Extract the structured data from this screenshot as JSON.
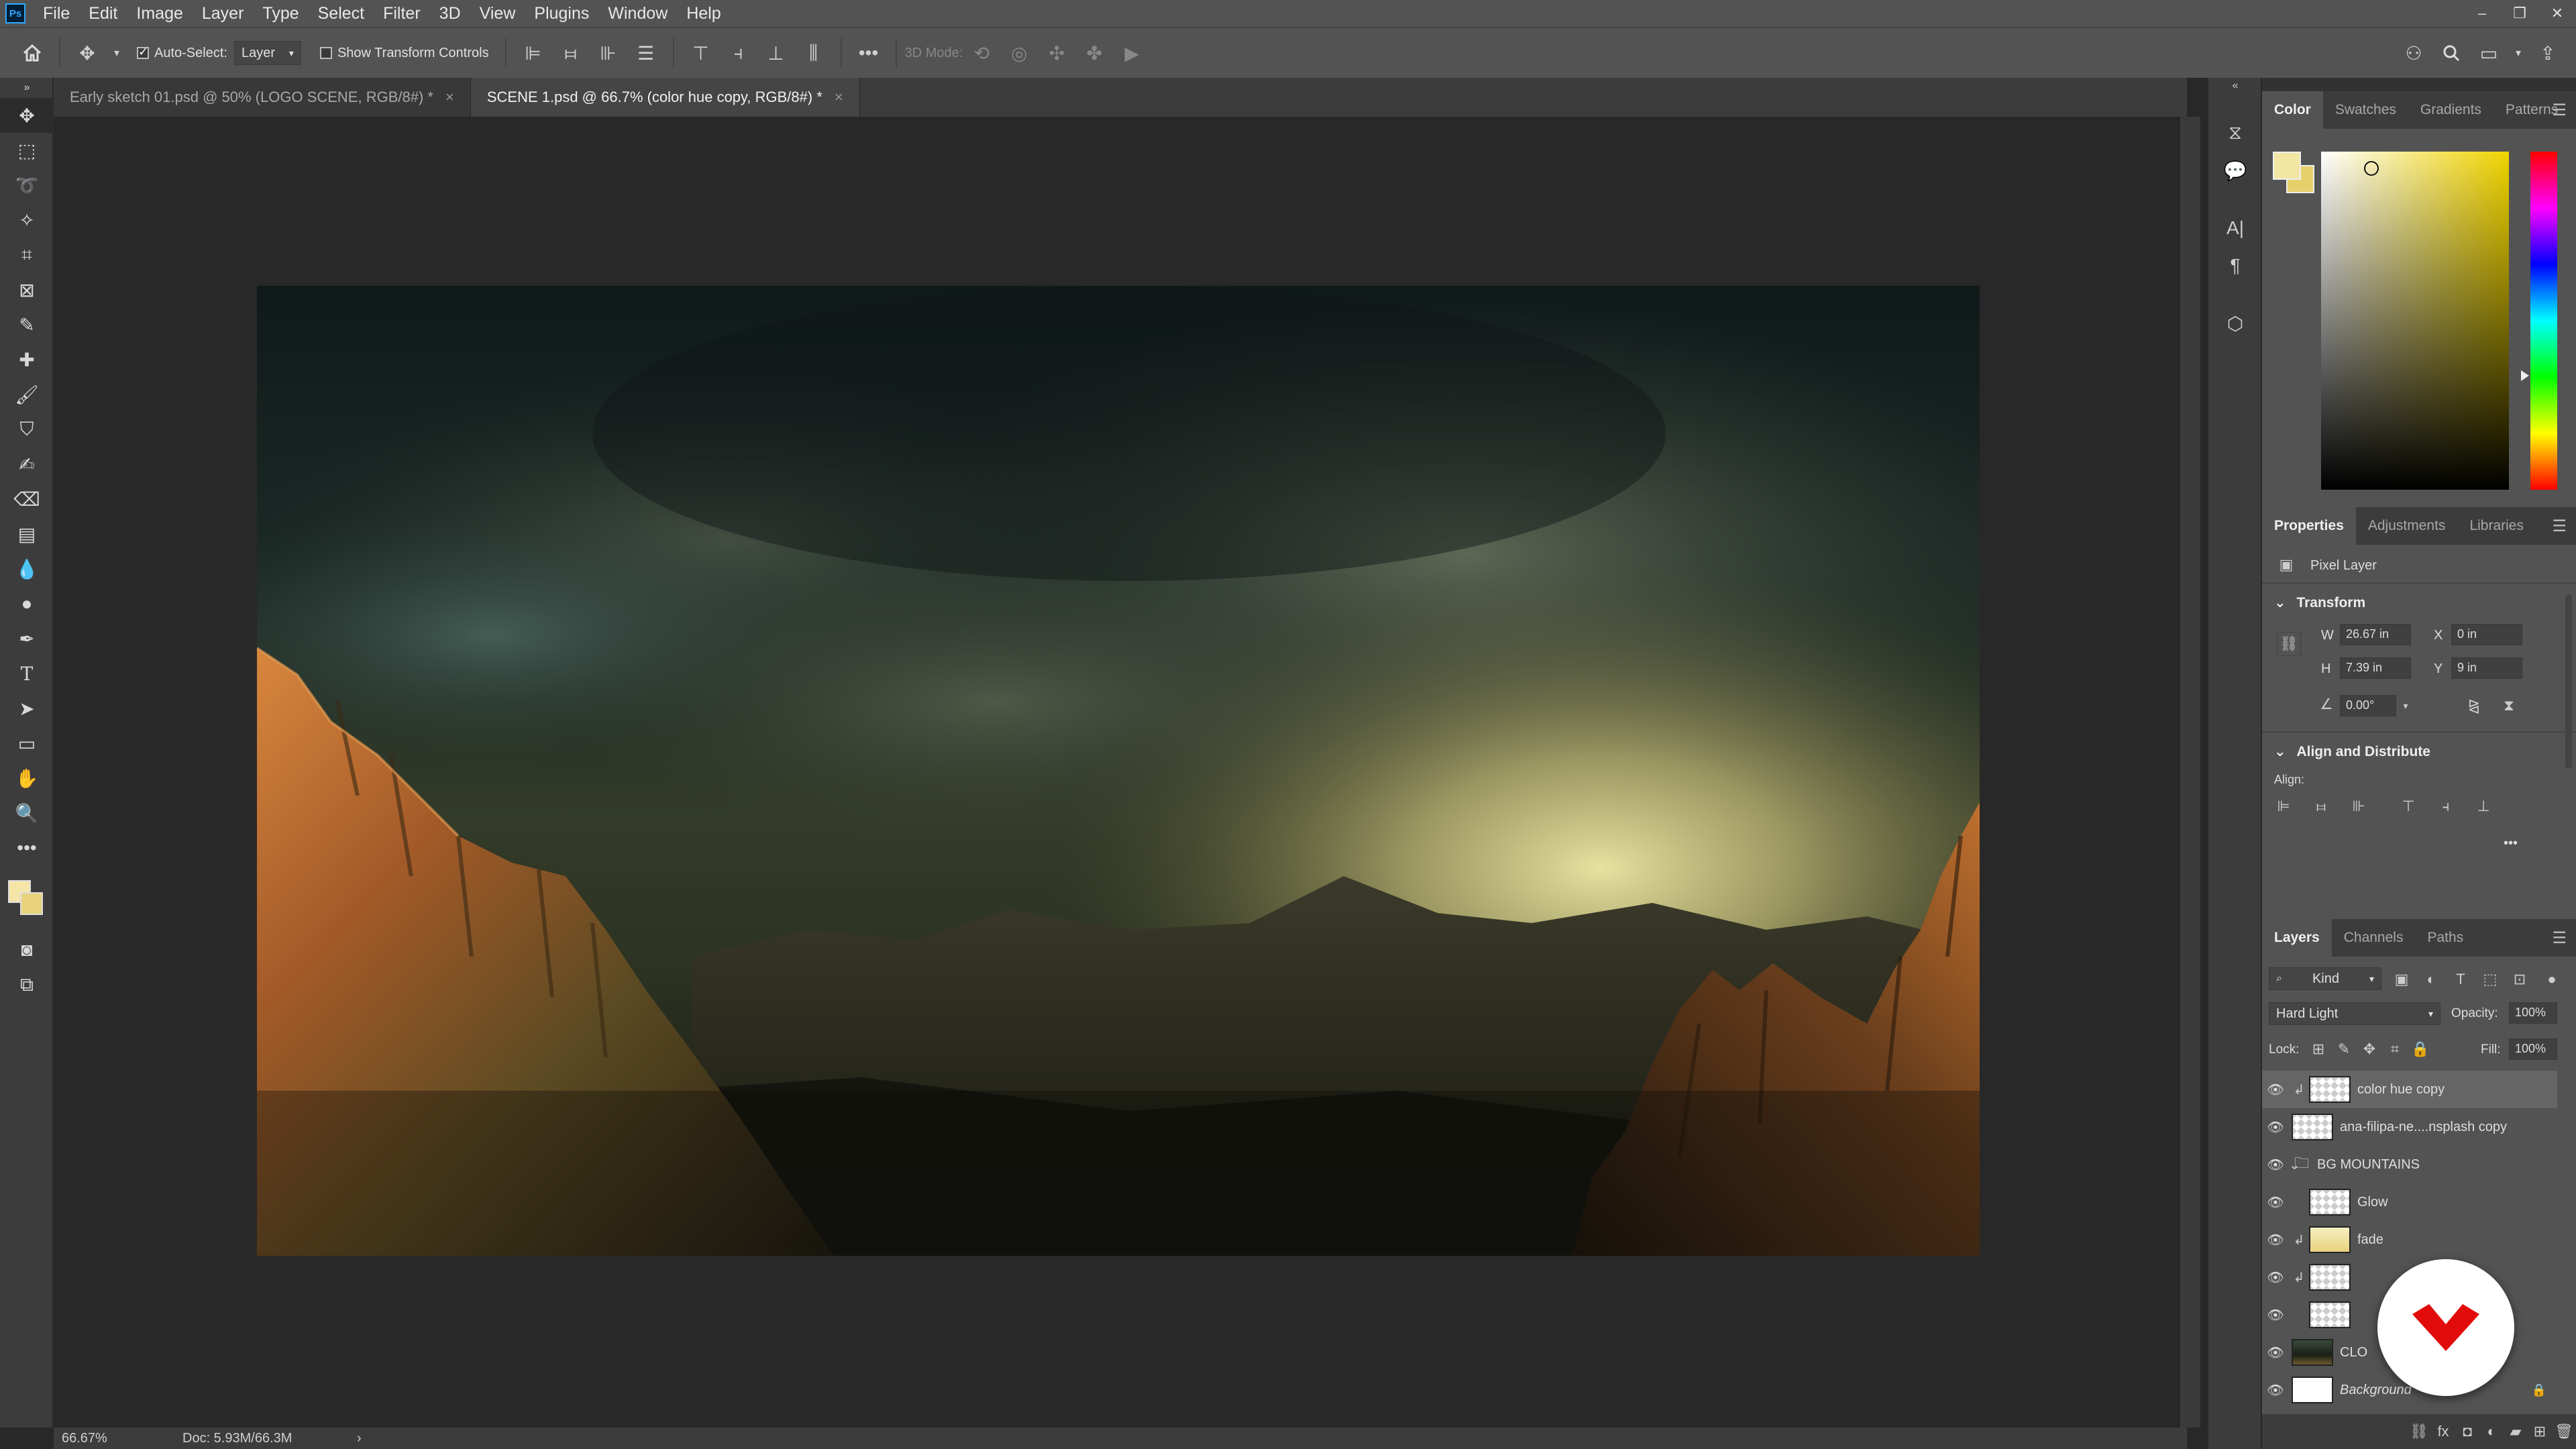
{
  "app": {
    "logo": "Ps"
  },
  "menu": [
    "File",
    "Edit",
    "Image",
    "Layer",
    "Type",
    "Select",
    "Filter",
    "3D",
    "View",
    "Plugins",
    "Window",
    "Help"
  ],
  "options": {
    "auto_select_label": "Auto-Select:",
    "auto_select_checked": true,
    "target": "Layer",
    "transform_controls_label": "Show Transform Controls",
    "mode_3d_label": "3D Mode:"
  },
  "tabs": [
    {
      "label": "Early sketch 01.psd @ 50% (LOGO SCENE, RGB/8#) *",
      "close": "×",
      "active": false
    },
    {
      "label": "SCENE 1.psd @ 66.7% (color hue copy, RGB/8#) *",
      "close": "×",
      "active": true
    }
  ],
  "status": {
    "zoom": "66.67%",
    "doc": "Doc: 5.93M/66.3M",
    "arrow": "›"
  },
  "color_panel": {
    "tabs": [
      "Color",
      "Swatches",
      "Gradients",
      "Patterns"
    ],
    "foreground": "#f2e6a4",
    "background": "#e6d06c"
  },
  "properties_panel": {
    "tabs": [
      "Properties",
      "Adjustments",
      "Libraries"
    ],
    "kind": "Pixel Layer",
    "transform_title": "Transform",
    "w_label": "W",
    "w": "26.67 in",
    "h_label": "H",
    "h": "7.39 in",
    "x_label": "X",
    "x": "0 in",
    "y_label": "Y",
    "y": "9 in",
    "angle": "0.00°",
    "align_title": "Align and Distribute",
    "align_label": "Align:",
    "more": "•••"
  },
  "layers_panel": {
    "tabs": [
      "Layers",
      "Channels",
      "Paths"
    ],
    "filter_label": "Kind",
    "blend_mode": "Hard Light",
    "opacity_label": "Opacity:",
    "opacity": "100%",
    "lock_label": "Lock:",
    "fill_label": "Fill:",
    "fill": "100%",
    "layers": [
      {
        "name": "color hue copy",
        "thumb": "checker",
        "indent": 1,
        "selected": true,
        "clip": true
      },
      {
        "name": "ana-filipa-ne....nsplash copy",
        "thumb": "checker",
        "indent": 0,
        "selected": false,
        "clip": false
      },
      {
        "name": "BG MOUNTAINS",
        "thumb": "folder",
        "indent": 0,
        "selected": false,
        "clip": false
      },
      {
        "name": "Glow",
        "thumb": "checker",
        "indent": 1,
        "selected": false,
        "clip": false
      },
      {
        "name": "fade",
        "thumb": "yellow",
        "indent": 1,
        "selected": false,
        "clip": true
      },
      {
        "name": "",
        "thumb": "checker",
        "indent": 1,
        "selected": false,
        "clip": true
      },
      {
        "name": "",
        "thumb": "checker",
        "indent": 1,
        "selected": false,
        "clip": false
      },
      {
        "name": "CLO",
        "thumb": "img",
        "indent": 0,
        "selected": false,
        "clip": false
      },
      {
        "name": "Background",
        "thumb": "white",
        "indent": 0,
        "selected": false,
        "clip": false,
        "locked": true
      }
    ]
  }
}
